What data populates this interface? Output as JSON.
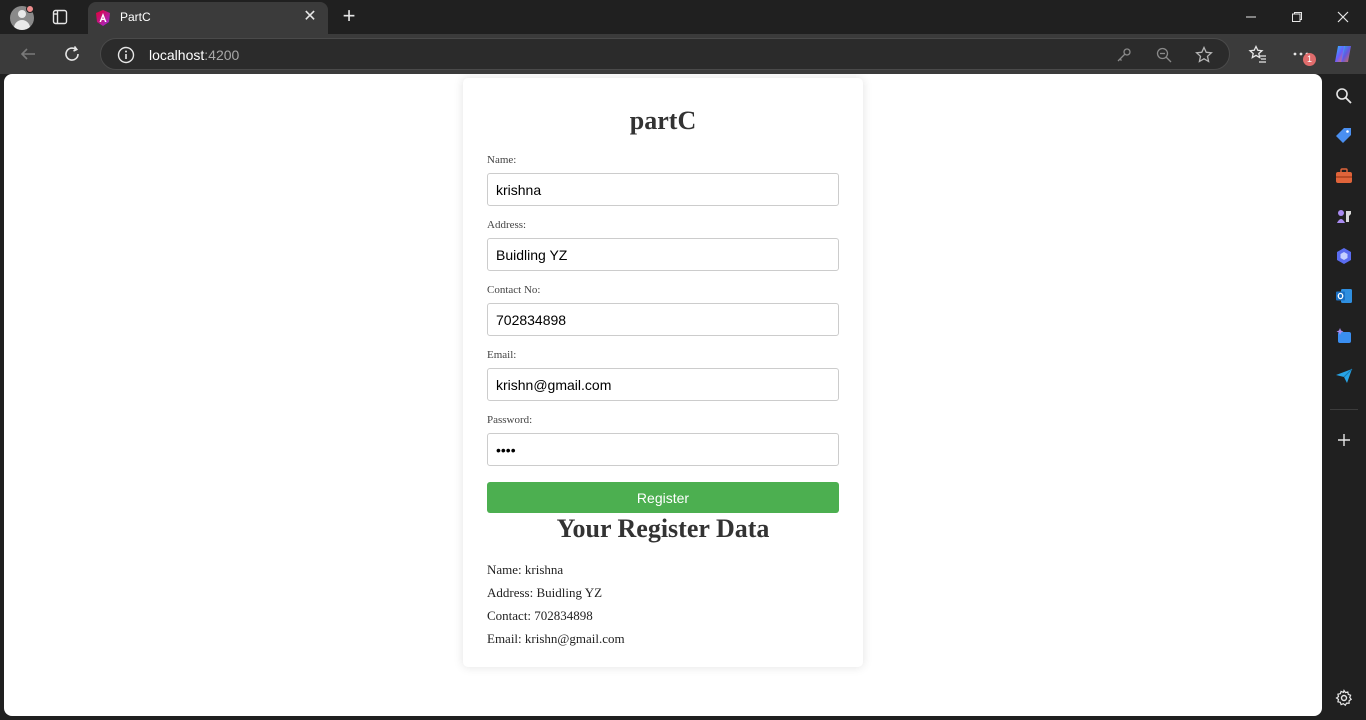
{
  "browser": {
    "tab_title": "PartC",
    "tab_close": "✕",
    "new_tab": "+",
    "url_host": "localhost",
    "url_port": ":4200",
    "menu_badge": "1"
  },
  "icons": {
    "profile": "profile-avatar-icon",
    "tab_actions": "tab-actions-icon",
    "favicon": "angular-icon",
    "back": "back-arrow-icon",
    "reload": "reload-icon",
    "site_info": "info-icon",
    "key": "key-icon",
    "zoom": "zoom-out-icon",
    "favorite": "star-icon",
    "favorites": "favorites-icon",
    "menu": "more-icon",
    "copilot": "copilot-icon",
    "sidebar": [
      "search-icon",
      "shopping-tag-icon",
      "tools-icon",
      "games-icon",
      "copilot-edge-icon",
      "outlook-icon",
      "designer-icon",
      "send-icon",
      "add-icon",
      "settings-icon"
    ]
  },
  "form": {
    "title": "partC",
    "name_label": "Name:",
    "name_value": "krishna",
    "address_label": "Address:",
    "address_value": "Buidling YZ",
    "contact_label": "Contact No:",
    "contact_value": "702834898",
    "email_label": "Email:",
    "email_value": "krishn@gmail.com",
    "password_label": "Password:",
    "password_value": "1234",
    "register_label": "Register"
  },
  "result": {
    "title": "Your Register Data",
    "name": "Name: krishna",
    "address": "Address: Buidling YZ",
    "contact": "Contact: 702834898",
    "email": "Email: krishn@gmail.com"
  },
  "colors": {
    "register_button": "#4caf50",
    "browser_dark": "#202020",
    "toolbar": "#3b3b3b"
  }
}
